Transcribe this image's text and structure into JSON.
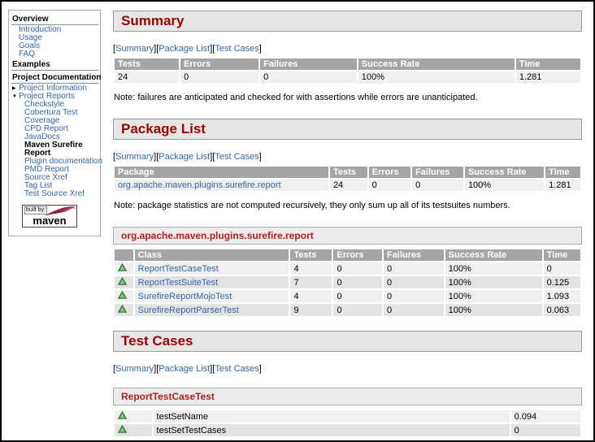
{
  "colors": {
    "accent_red": "#990000",
    "link_blue": "#3366aa",
    "table_header_bg": "#a5a5a5",
    "row_light": "#f0f0f0",
    "row_dark": "#e3e3e3",
    "success_green": "#4e9a4e",
    "feather_maroon": "#8e2444"
  },
  "icons": {
    "collapsed_arrow": "▶",
    "expanded_arrow": "▼"
  },
  "sidebar": {
    "overview": {
      "title": "Overview",
      "items": [
        "Introduction",
        "Usage",
        "Goals",
        "FAQ"
      ]
    },
    "examples": {
      "title": "Examples"
    },
    "project_documentation": {
      "title": "Project Documentation",
      "project_information": "Project Information",
      "project_reports": "Project Reports",
      "reports_before": [
        "Checkstyle",
        "Cobertura Test",
        "Coverage",
        "CPD Report",
        "JavaDocs"
      ],
      "current_page": "Maven Surefire Report",
      "reports_after": [
        "Plugin documentation",
        "PMD Report",
        "Source Xref",
        "Tag List",
        "Test Source Xref"
      ]
    },
    "logo": {
      "built_by": "built by:",
      "brand": "maven"
    }
  },
  "navlinks": {
    "bracket_open": "[",
    "bracket_close": "]",
    "items": [
      "Summary",
      "Package List",
      "Test Cases"
    ]
  },
  "summary": {
    "title": "Summary",
    "columns": [
      "Tests",
      "Errors",
      "Failures",
      "Success Rate",
      "Time"
    ],
    "row": [
      "24",
      "0",
      "0",
      "100%",
      "1.281"
    ],
    "note": "Note: failures are anticipated and checked for with assertions while errors are unanticipated."
  },
  "packages": {
    "title": "Package List",
    "columns": [
      "Package",
      "Tests",
      "Errors",
      "Failures",
      "Success Rate",
      "Time"
    ],
    "rows": [
      {
        "name": "org.apache.maven.plugins.surefire.report",
        "tests": "24",
        "errors": "0",
        "failures": "0",
        "success_rate": "100%",
        "time": "1.281"
      }
    ],
    "note": "Note: package statistics are not computed recursively, they only sum up all of its testsuites numbers."
  },
  "package_detail": {
    "title": "org.apache.maven.plugins.surefire.report",
    "columns": [
      "Class",
      "Tests",
      "Errors",
      "Failures",
      "Success Rate",
      "Time"
    ],
    "rows": [
      {
        "name": "ReportTestCaseTest",
        "tests": "4",
        "errors": "0",
        "failures": "0",
        "success_rate": "100%",
        "time": "0"
      },
      {
        "name": "ReportTestSuiteTest",
        "tests": "7",
        "errors": "0",
        "failures": "0",
        "success_rate": "100%",
        "time": "0.125"
      },
      {
        "name": "SurefireReportMojoTest",
        "tests": "4",
        "errors": "0",
        "failures": "0",
        "success_rate": "100%",
        "time": "1.093"
      },
      {
        "name": "SurefireReportParserTest",
        "tests": "9",
        "errors": "0",
        "failures": "0",
        "success_rate": "100%",
        "time": "0.063"
      }
    ]
  },
  "test_cases": {
    "title": "Test Cases",
    "class_title": "ReportTestCaseTest",
    "rows": [
      {
        "name": "testSetName",
        "time": "0.094"
      },
      {
        "name": "testSetTestCases",
        "time": "0"
      }
    ]
  }
}
